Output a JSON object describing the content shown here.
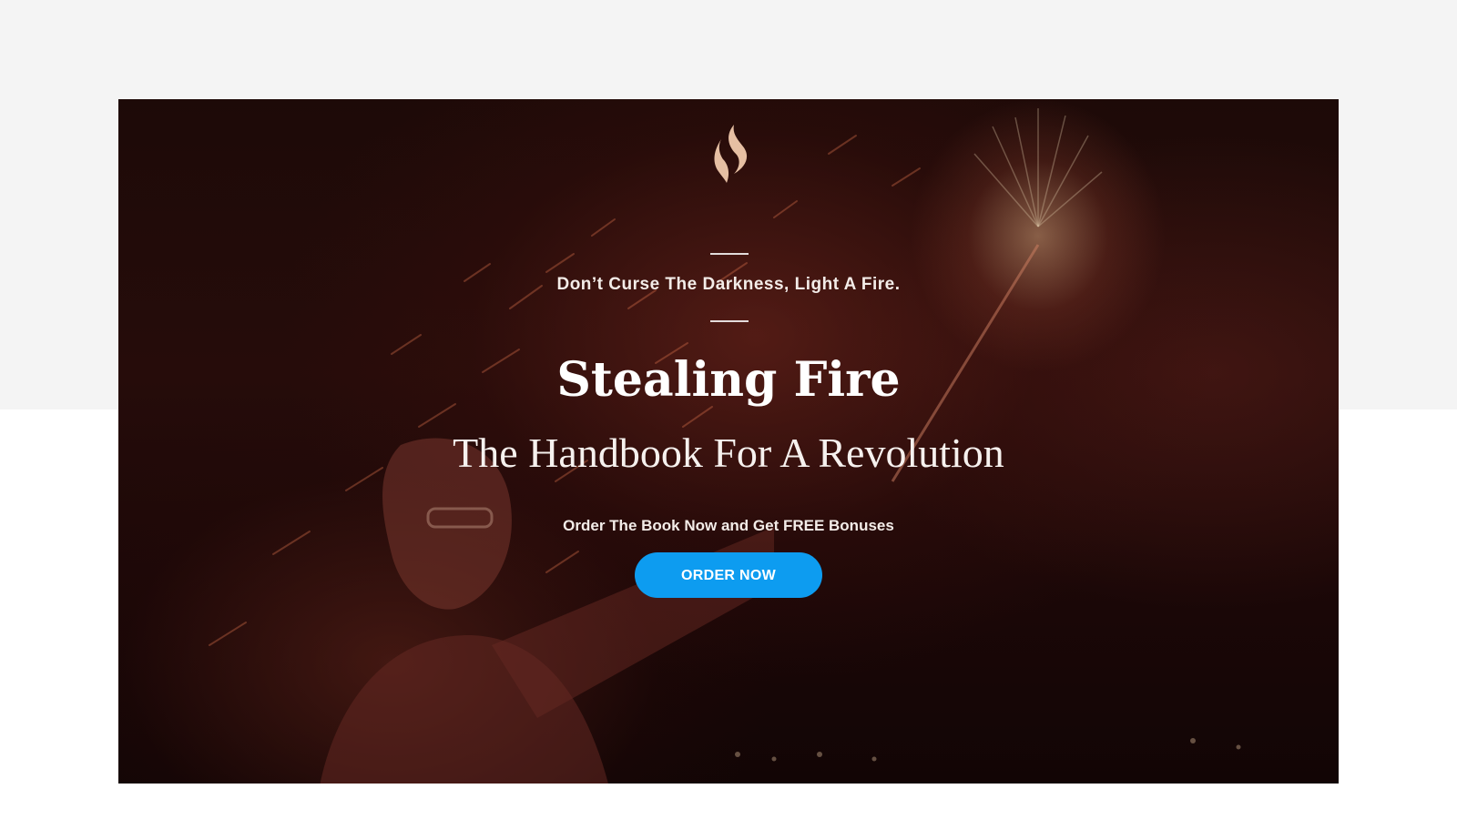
{
  "hero": {
    "logo_icon": "flame-logo-icon",
    "tagline": "Don’t Curse The Darkness, Light A Fire.",
    "title": "Stealing Fire",
    "subtitle": "The Handbook For A Revolution",
    "offer_text": "Order The Book Now and Get FREE Bonuses",
    "order_button_label": "ORDER NOW"
  },
  "colors": {
    "page_top_band": "#f4f4f4",
    "page_bottom": "#ffffff",
    "hero_overlay": "#1d0a08",
    "logo": "#e6bfa3",
    "button": "#0d9cf0",
    "text": "#ffffff"
  }
}
